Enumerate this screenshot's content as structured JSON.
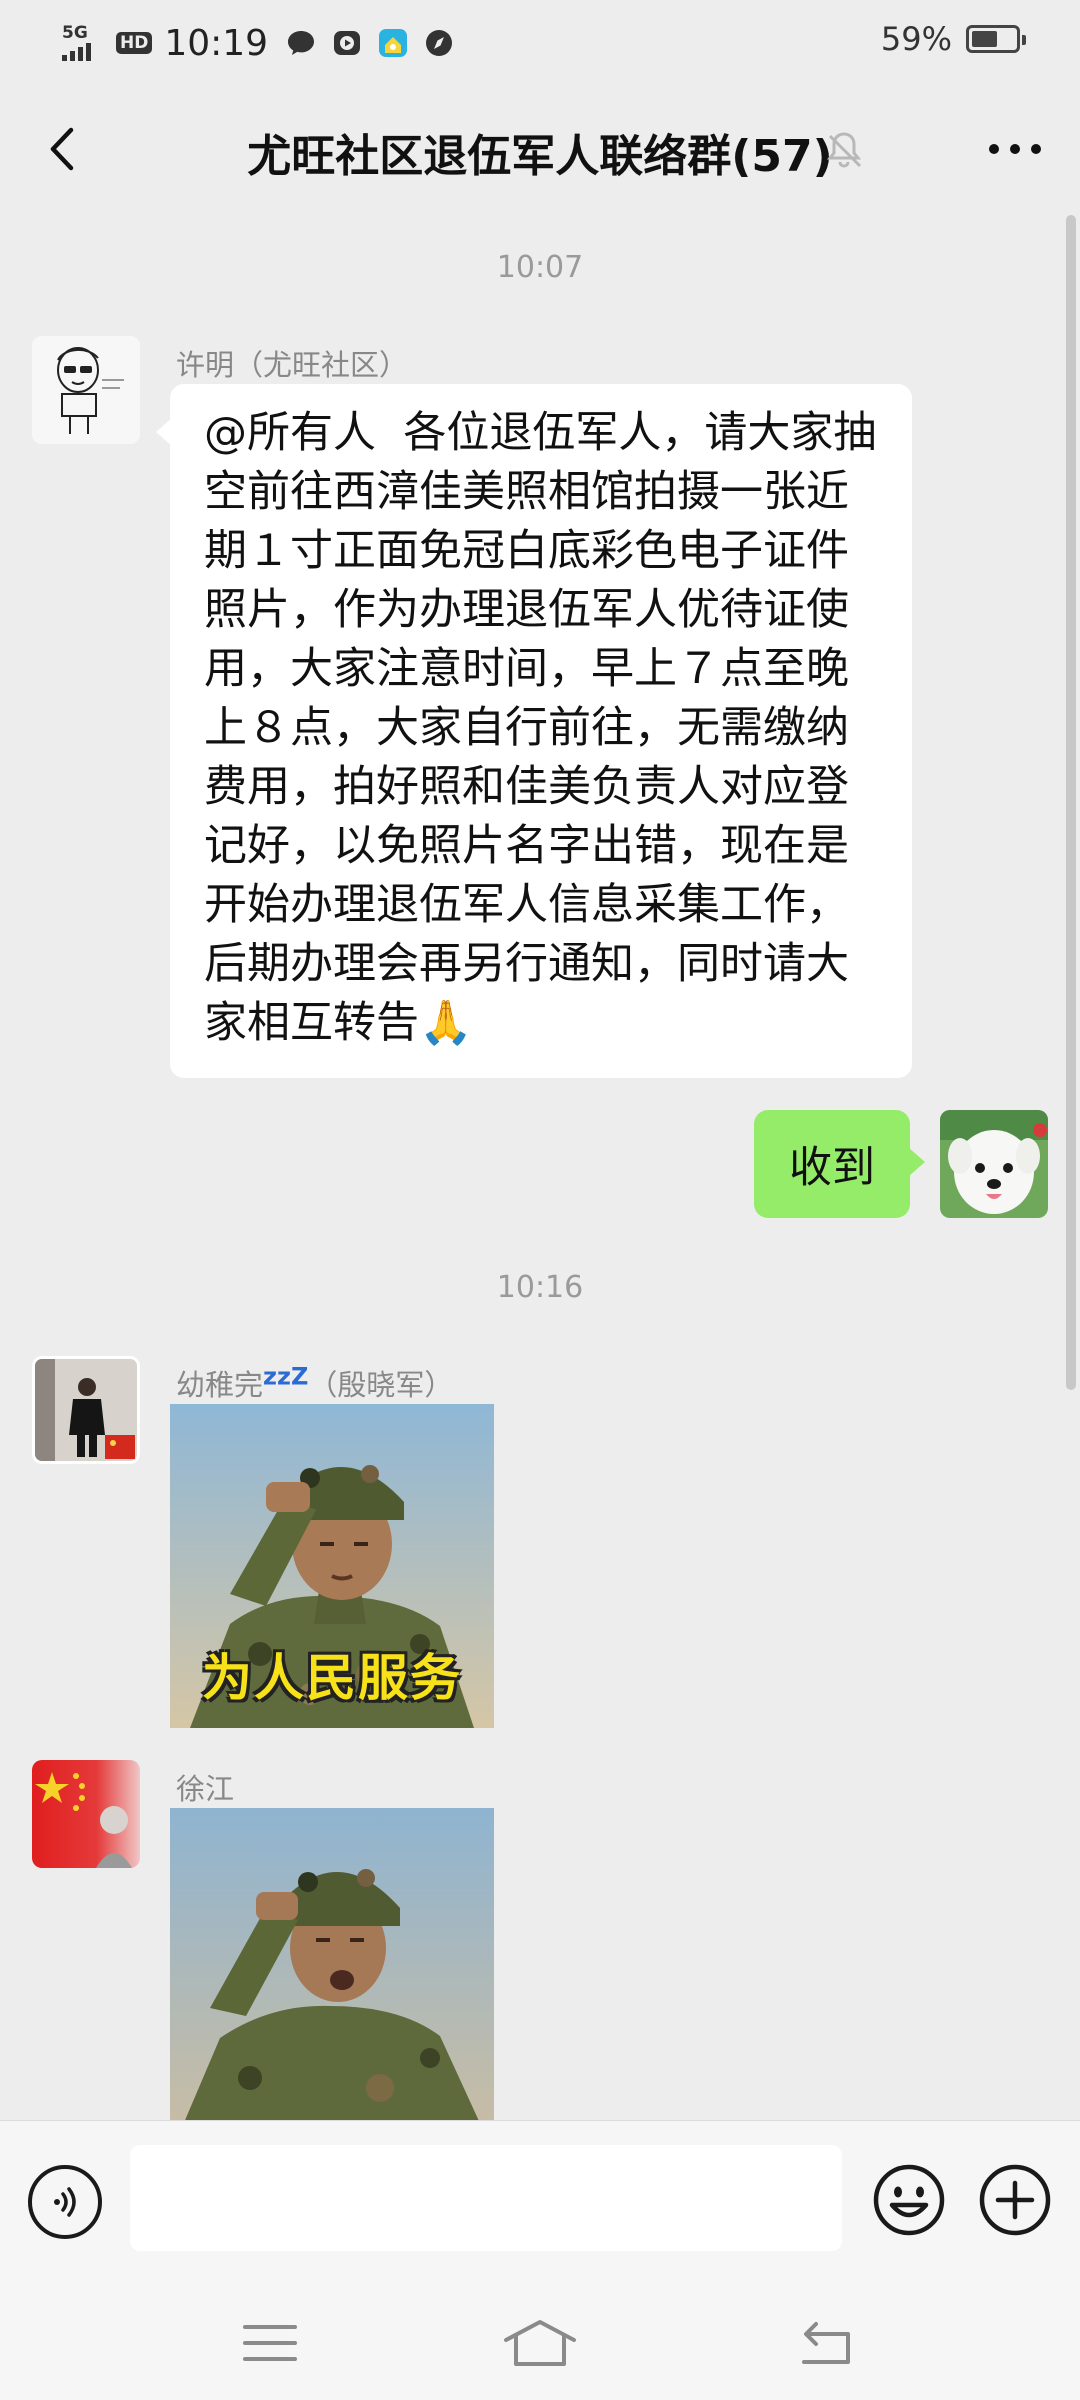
{
  "status_bar": {
    "network": "5G",
    "hd": "HD",
    "time": "10:19",
    "battery_percent": "59%",
    "battery_level": 0.59
  },
  "header": {
    "title": "尤旺社区退伍军人联络群(57)"
  },
  "chat": {
    "messages": [
      {
        "type": "timestamp",
        "text": "10:07"
      },
      {
        "type": "text",
        "side": "left",
        "sender": "许明（尤旺社区）",
        "text": "@所有人  各位退伍军人，请大家抽空前往西漳佳美照相馆拍摄一张近期１寸正面免冠白底彩色电子证件照片，作为办理退伍军人优待证使用，大家注意时间，早上７点至晚上８点，大家自行前往，无需缴纳费用，拍好照和佳美负责人对应登记好，以免照片名字出错，现在是开始办理退伍军人信息采集工作，后期办理会再另行通知，同时请大家相互转告🙏"
      },
      {
        "type": "text",
        "side": "right",
        "text": "收到"
      },
      {
        "type": "timestamp",
        "text": "10:16"
      },
      {
        "type": "sticker",
        "side": "left",
        "sender": "幼稚完",
        "sender_sleep": "zzZ",
        "sender_suffix": "（殷晓军）",
        "caption": "为人民服务"
      },
      {
        "type": "sticker",
        "side": "left",
        "sender": "徐江",
        "caption": ""
      }
    ]
  },
  "input": {
    "placeholder": ""
  },
  "colors": {
    "background": "#ededed",
    "bubble_self": "#95ec69",
    "bubble_other": "#ffffff"
  }
}
